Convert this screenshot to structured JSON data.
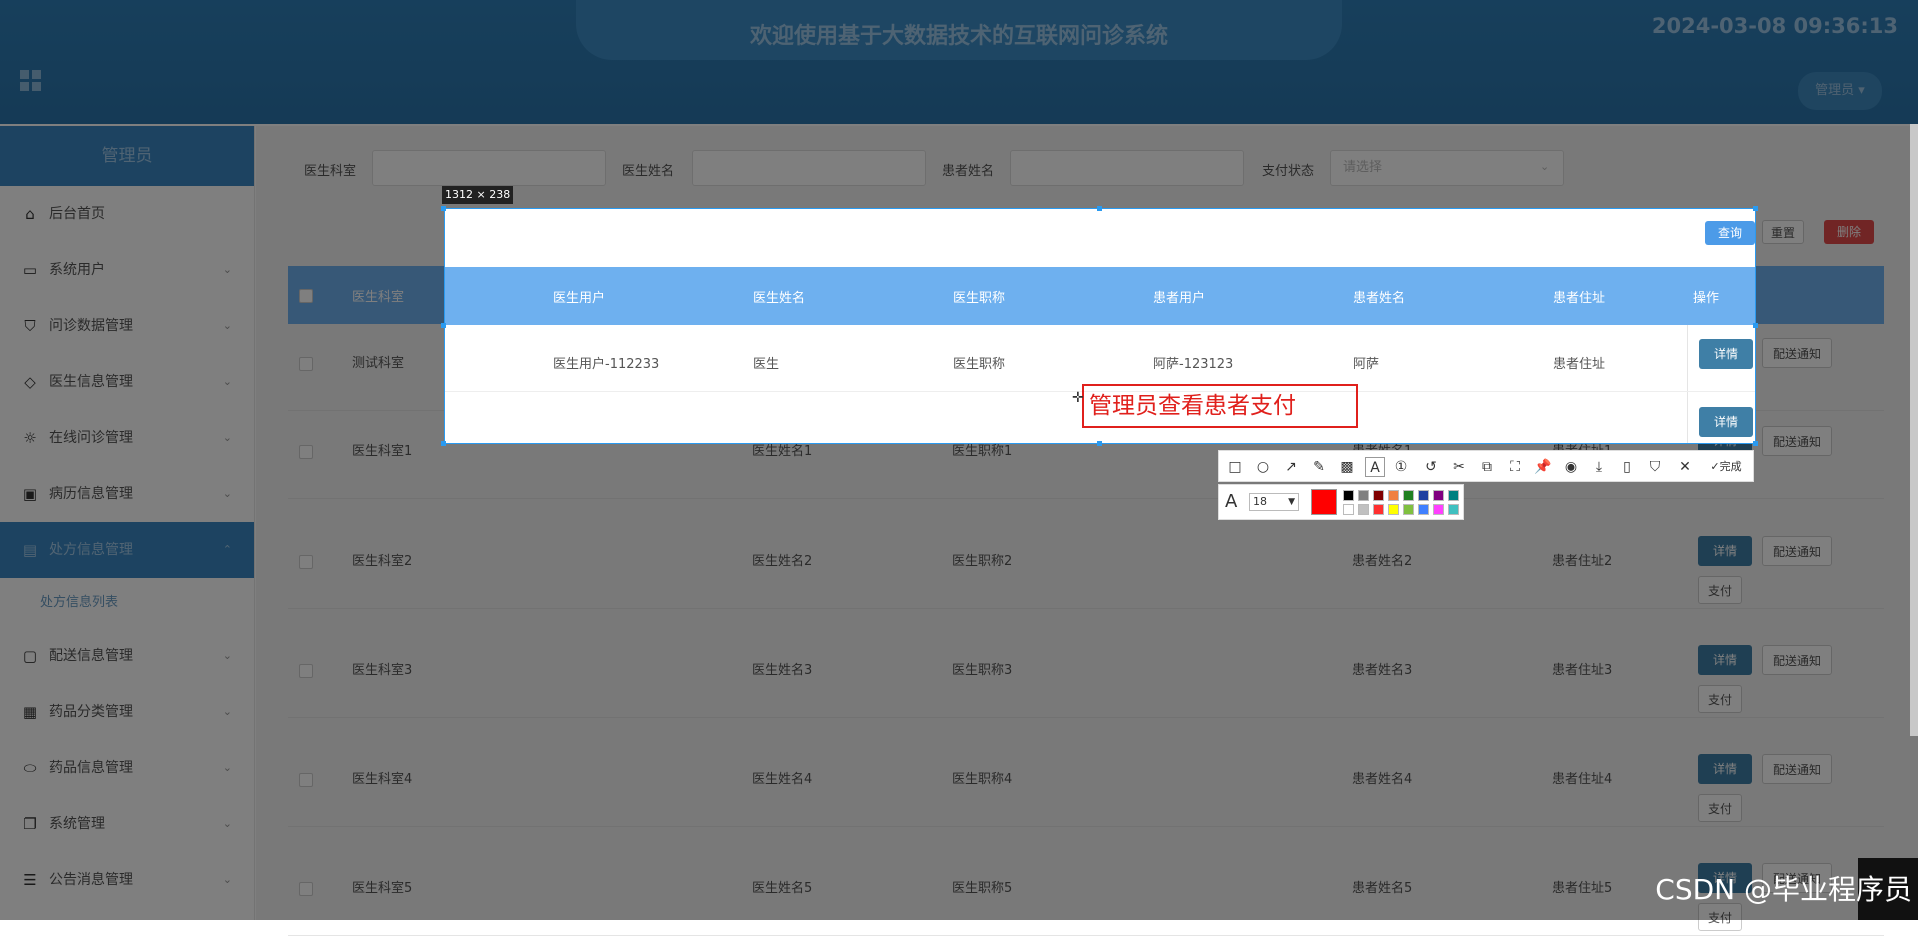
{
  "header": {
    "title": "欢迎使用基于大数据技术的互联网问诊系统",
    "datetime": "2024-03-08 09:36:13",
    "user_menu": "管理员 ▾"
  },
  "sidebar": {
    "role": "管理员",
    "items": [
      {
        "label": "后台首页",
        "icon": "home-icon",
        "glyph": "⌂",
        "arrow": ""
      },
      {
        "label": "系统用户",
        "icon": "monitor-icon",
        "glyph": "▭",
        "arrow": "⌄"
      },
      {
        "label": "问诊数据管理",
        "icon": "bookmark-icon",
        "glyph": "⛉",
        "arrow": "⌄"
      },
      {
        "label": "医生信息管理",
        "icon": "tag-icon",
        "glyph": "◇",
        "arrow": "⌄"
      },
      {
        "label": "在线问诊管理",
        "icon": "sun-icon",
        "glyph": "☼",
        "arrow": "⌄"
      },
      {
        "label": "病历信息管理",
        "icon": "inbox-icon",
        "glyph": "▣",
        "arrow": "⌄"
      },
      {
        "label": "处方信息管理",
        "icon": "clipboard-icon",
        "glyph": "▤",
        "arrow": "⌃"
      },
      {
        "label": "配送信息管理",
        "icon": "chat-icon",
        "glyph": "▢",
        "arrow": "⌄"
      },
      {
        "label": "药品分类管理",
        "icon": "box-icon",
        "glyph": "▦",
        "arrow": "⌄"
      },
      {
        "label": "药品信息管理",
        "icon": "pill-icon",
        "glyph": "⬭",
        "arrow": "⌄"
      },
      {
        "label": "系统管理",
        "icon": "copy-icon",
        "glyph": "❐",
        "arrow": "⌄"
      },
      {
        "label": "公告消息管理",
        "icon": "sliders-icon",
        "glyph": "☰",
        "arrow": "⌄"
      }
    ],
    "sub_item": "处方信息列表"
  },
  "search": {
    "dept_label": "医生科室",
    "doctor_label": "医生姓名",
    "patient_label": "患者姓名",
    "pay_label": "支付状态",
    "pay_placeholder": "请选择",
    "query": "查询",
    "reset": "重置",
    "delete": "删除"
  },
  "table": {
    "columns": [
      "医生科室",
      "医生用户",
      "医生姓名",
      "医生职称",
      "患者用户",
      "患者姓名",
      "患者住址",
      "操作"
    ],
    "rows": [
      {
        "dept": "测试科室",
        "doc_user": "医生用户-112233",
        "doc_name": "医生",
        "title": "医生职称",
        "pat_user": "阿萨-123123",
        "pat_name": "阿萨",
        "addr": "患者住址",
        "pay": false
      },
      {
        "dept": "医生科室1",
        "doc_user": "",
        "doc_name": "医生姓名1",
        "title": "医生职称1",
        "pat_user": "",
        "pat_name": "患者姓名1",
        "addr": "患者住址1",
        "pay": false
      },
      {
        "dept": "医生科室2",
        "doc_user": "",
        "doc_name": "医生姓名2",
        "title": "医生职称2",
        "pat_user": "",
        "pat_name": "患者姓名2",
        "addr": "患者住址2",
        "pay": true
      },
      {
        "dept": "医生科室3",
        "doc_user": "",
        "doc_name": "医生姓名3",
        "title": "医生职称3",
        "pat_user": "",
        "pat_name": "患者姓名3",
        "addr": "患者住址3",
        "pay": true
      },
      {
        "dept": "医生科室4",
        "doc_user": "",
        "doc_name": "医生姓名4",
        "title": "医生职称4",
        "pat_user": "",
        "pat_name": "患者姓名4",
        "addr": "患者住址4",
        "pay": true
      },
      {
        "dept": "医生科室5",
        "doc_user": "",
        "doc_name": "医生姓名5",
        "title": "医生职称5",
        "pat_user": "",
        "pat_name": "患者姓名5",
        "addr": "患者住址5",
        "pay": true
      }
    ],
    "detail": "详情",
    "notify": "配送通知",
    "pay": "支付"
  },
  "screenshot_tool": {
    "size_label": "1312 × 238",
    "annotation_text": "管理员查看患者支付",
    "font_size": "18",
    "done": "完成",
    "current_color": "#ff0000",
    "palette": [
      "#000000",
      "#808080",
      "#800000",
      "#f08040",
      "#208020",
      "#2040a0",
      "#800080",
      "#008080",
      "#ffffff",
      "#c0c0c0",
      "#ff3030",
      "#ffff00",
      "#80c040",
      "#4080ff",
      "#ff40ff",
      "#40c0c0"
    ]
  },
  "watermark": "CSDN @毕业程序员"
}
